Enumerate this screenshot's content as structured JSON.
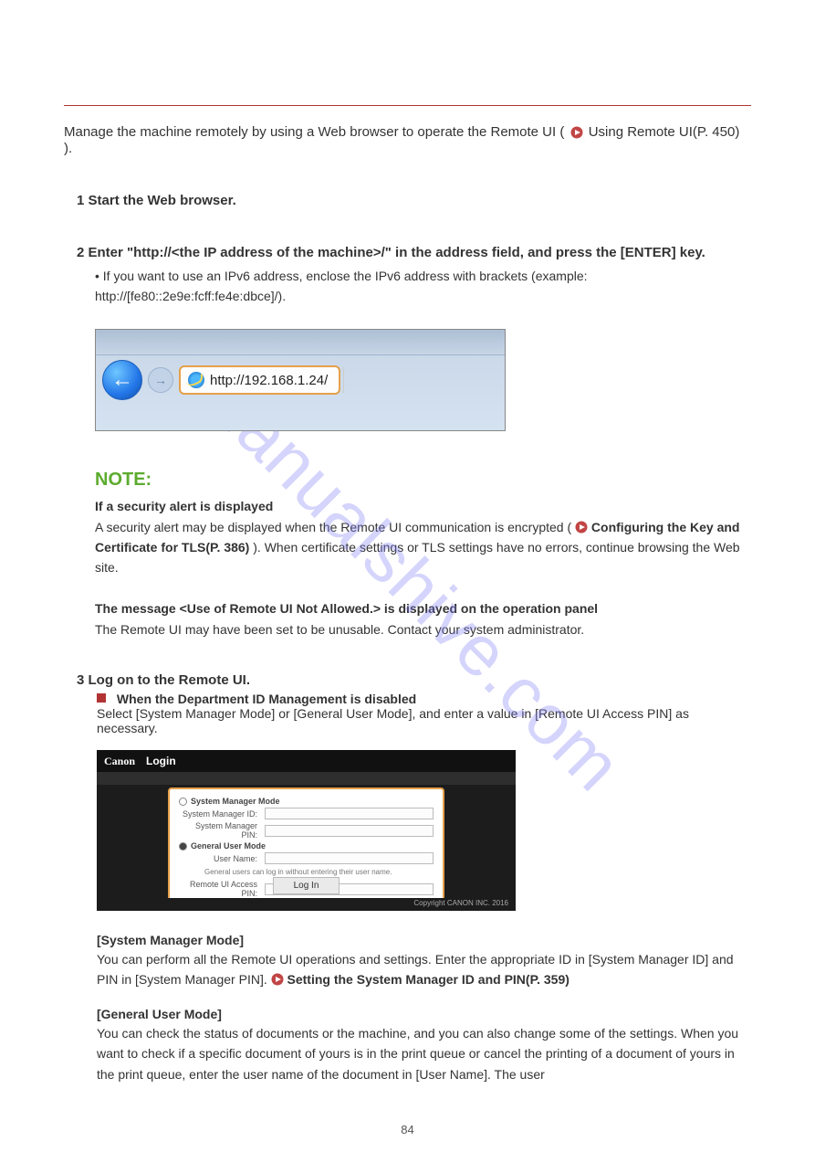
{
  "watermark": "manualshive.com",
  "header_note": "Manage the machine remotely by using a Web browser to operate the Remote UI (",
  "header_link": "Using Remote UI(P. 450)",
  "header_note_end": ").",
  "step1": {
    "label": "1 Start the Web browser."
  },
  "step2": {
    "label": "2 Enter \"http://<the IP address of the machine>/\" in the address field, and press the [ENTER] key.",
    "bullet": "If you want to use an IPv6 address, enclose the IPv6 address with brackets (example: http://[fe80::2e9e:fcff:fe4e:dbce]/)."
  },
  "browser": {
    "url": "http://192.168.1.24/"
  },
  "note": {
    "label": "NOTE:",
    "title": "If a security alert is displayed",
    "body_pre": "A security alert may be displayed when the Remote UI communication is encrypted ( ",
    "body_link": "Configuring the Key and Certificate for TLS(P. 386)",
    "body_post": " ). When certificate settings or TLS settings have no errors, continue browsing the Web site.",
    "q_title": "The message <Use of Remote UI Not Allowed.> is displayed on the operation panel",
    "q_body": "The Remote UI may have been set to be unusable. Contact your system administrator."
  },
  "step3": {
    "heading": "3 Log on to the Remote UI.",
    "intro": "When the Department ID Management is disabled",
    "desc": "Select [System Manager Mode] or [General User Mode], and enter a value in [Remote UI Access PIN] as necessary."
  },
  "login": {
    "brand": "Canon",
    "title": "Login",
    "sysmgr": "System Manager Mode",
    "sysmgr_id": "System Manager ID:",
    "sysmgr_pin": "System Manager PIN:",
    "genuser": "General User Mode",
    "username": "User Name:",
    "gen_note": "General users can log in without entering their user name.",
    "access_pin": "Remote UI Access PIN:",
    "login_btn": "Log In",
    "copyright": "Copyright CANON INC. 2016"
  },
  "sysmgr_block": {
    "title": "[System Manager Mode]",
    "body_pre": "You can perform all the Remote UI operations and settings. Enter the appropriate ID in [System Manager ID] and PIN in [System Manager PIN]. ",
    "body_link": "Setting the System Manager ID and PIN(P. 359)"
  },
  "genuser_block": {
    "title": "[General User Mode]",
    "body": "You can check the status of documents or the machine, and you can also change some of the settings. When you want to check if a specific document of yours is in the print queue or cancel the printing of a document of yours in the print queue, enter the user name of the document in [User Name]. The user"
  },
  "page_number": "84"
}
